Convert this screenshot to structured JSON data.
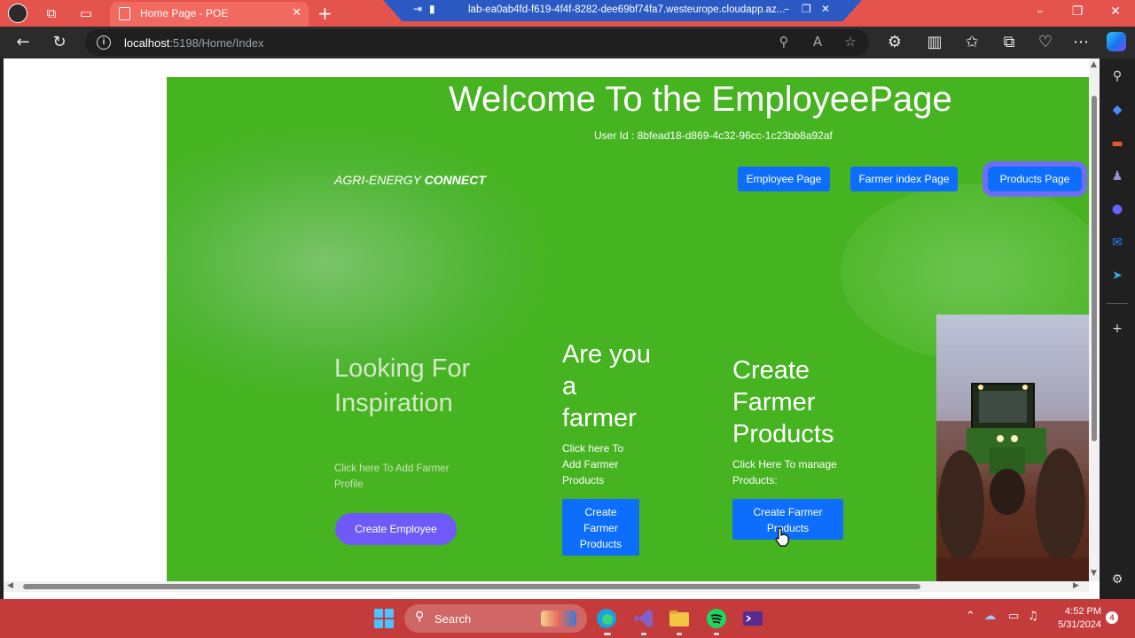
{
  "browser": {
    "tab_title": "Home Page - POE",
    "remote_session_title": "lab-ea0ab4fd-f619-4f4f-8282-dee69bf74fa7.westeurope.cloudapp.az...",
    "address_host": "localhost",
    "address_path": ":5198/Home/Index"
  },
  "page": {
    "welcome_heading": "Welcome To the EmployeePage",
    "user_id_text": "User Id : 8bfead18-d869-4c32-96cc-1c23bb8a92af",
    "brand_normal": "AGRI-ENERGY ",
    "brand_bold": "CONNECT",
    "nav": {
      "employee_page": "Employee Page",
      "farmer_index_page": "Farmer index Page",
      "products_page": "Products Page"
    },
    "col1": {
      "heading": "Looking For Inspiration",
      "text": "Click here To Add Farmer Profile",
      "button": "Create Employee"
    },
    "col2": {
      "heading": "Are you a farmer",
      "text": "Click here To Add Farmer Products",
      "button": "Create Farmer Products"
    },
    "col3": {
      "heading": "Create Farmer Products",
      "text": "Click Here To manage Products:",
      "button": "Create Farmer Products"
    }
  },
  "taskbar": {
    "search_label": "Search",
    "time": "4:52 PM",
    "date": "5/31/2024",
    "notification_count": "4"
  },
  "colors": {
    "page_green": "#46b320",
    "primary_blue": "#0d6efd",
    "purple": "#6f5af7",
    "tab_bar_red": "#e4544d",
    "taskbar_red": "#c43b3b"
  }
}
